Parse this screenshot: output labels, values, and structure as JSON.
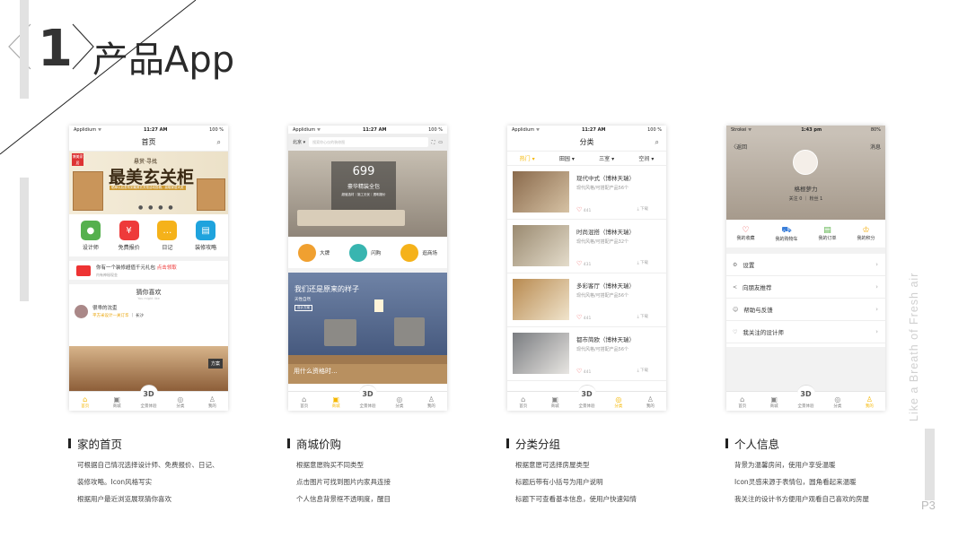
{
  "header": {
    "number": "1",
    "title": "产品App"
  },
  "side_text": "Like a Breath of Fresh air",
  "page_number": "P3",
  "phone1": {
    "status": {
      "carrier": "Applidium ᯤ",
      "time": "11:27 AM",
      "battery": "100 %"
    },
    "title": "首页",
    "banner": {
      "label": "博美家居",
      "small": "悬赏·寻找",
      "big": "最美玄关柜",
      "sub": "晒单以后发布到最美玄关柜活动投稿，赢取家居大奖"
    },
    "grid": [
      {
        "label": "设计师",
        "color": "#55b04e",
        "icon": "person"
      },
      {
        "label": "免费报价",
        "color": "#ee3a3a",
        "icon": "¥"
      },
      {
        "label": "日记",
        "color": "#f5b21a",
        "icon": "…"
      },
      {
        "label": "装修攻略",
        "color": "#1fa3dd",
        "icon": "▤"
      }
    ],
    "promo": {
      "text": "你有一个装修超值千元礼包",
      "link": "点击领取",
      "sub": "内有神秘现金"
    },
    "guess": {
      "title": "猜你喜欢",
      "sub": "You might like"
    },
    "designer": {
      "name": "很乖的沈歪",
      "detail": "平方米设计—关订华",
      "tag": "长沙"
    },
    "room_tag": "方案",
    "tabs": [
      "首页",
      "商城",
      "全景体验",
      "分类",
      "我的"
    ],
    "mid_icon": "3D"
  },
  "phone2": {
    "status": {
      "carrier": "Applidium ᯤ",
      "time": "11:27 AM",
      "battery": "100 %"
    },
    "location": "北京 ▾",
    "search_placeholder": "搜索你心仪的装修图",
    "hero": {
      "price": "699",
      "title": "豪华精装全包",
      "sub": "超值选材｜施工无忧｜透明报价"
    },
    "links": [
      {
        "label": "大牌",
        "color": "#f0a030"
      },
      {
        "label": "闪购",
        "color": "#38b5b0"
      },
      {
        "label": "逛商场",
        "color": "#f5b21a"
      }
    ],
    "feature": {
      "title": "我们还是原来的样子",
      "sub": "天性自然",
      "btn": "设计方案"
    },
    "strip": "用什么资格时...",
    "tabs": [
      "首页",
      "商城",
      "全景体验",
      "分类",
      "我的"
    ],
    "mid_icon": "3D"
  },
  "phone3": {
    "status": {
      "carrier": "Applidium ᯤ",
      "time": "11:27 AM",
      "battery": "100 %"
    },
    "title": "分类",
    "filters": [
      "热门 ▾",
      "田园 ▾",
      "三室 ▾",
      "空间 ▾"
    ],
    "items": [
      {
        "name": "现代中式（博林天瑞）",
        "desc": "现代风格/可搭配产品56个",
        "likes": "441",
        "download": "下载"
      },
      {
        "name": "时尚混搭（博林天瑞）",
        "desc": "现代风格/可搭配产品32个",
        "likes": "431",
        "download": "下载"
      },
      {
        "name": "多彩客厅（博林天瑞）",
        "desc": "现代风格/可搭配产品56个",
        "likes": "441",
        "download": "下载"
      },
      {
        "name": "都市简欧（博林天瑞）",
        "desc": "现代风格/可搭配产品56个",
        "likes": "441",
        "download": "下载"
      }
    ],
    "tabs": [
      "首页",
      "商城",
      "全景体验",
      "分类",
      "我的"
    ],
    "mid_icon": "3D"
  },
  "phone4": {
    "status": {
      "carrier": "Strokei ᯤ",
      "time": "1:43 pm",
      "battery": "80%"
    },
    "back": "〈返回",
    "message": "消息",
    "name": "格根萝力",
    "follow": "关注 0 ｜ 粉丝 1",
    "orders": [
      {
        "label": "我的收藏",
        "icon": "♡",
        "color": "#e44"
      },
      {
        "label": "我的购物车",
        "icon": "⛟",
        "color": "#3b7fd9"
      },
      {
        "label": "我的订单",
        "icon": "▤",
        "color": "#5bb34a"
      },
      {
        "label": "我的积分",
        "icon": "♔",
        "color": "#f5b21a"
      }
    ],
    "menu": [
      {
        "label": "设置",
        "icon": "⚙"
      },
      {
        "label": "向朋友推荐",
        "icon": "<"
      },
      {
        "label": "帮助与反馈",
        "icon": "☺"
      },
      {
        "label": "我关注的设计师",
        "icon": "♡"
      }
    ],
    "tabs": [
      "首页",
      "商城",
      "全景体验",
      "分类",
      "我的"
    ],
    "mid_icon": "3D"
  },
  "captions": [
    {
      "title": "家的首页",
      "lines": [
        "可根据自己情况选择设计师、免费报价、日记、",
        "装修攻略。Icon风格写实",
        "根据用户最近浏览展现猜你喜欢"
      ]
    },
    {
      "title": "商城价购",
      "lines": [
        "根据意愿购买不同类型",
        "点击图片可找到图片内家具连接",
        "个人信息背景框不透明度，醒目"
      ]
    },
    {
      "title": "分类分组",
      "lines": [
        "根据意愿可选择房屋类型",
        "标题后带有小括号为用户说明",
        "标题下可查看基本信息，使用户快速知情"
      ]
    },
    {
      "title": "个人信息",
      "lines": [
        "背景为温馨房间，使用户享受温暖",
        "Icon灵感来源于表情包，圆角看起来温暖",
        "我关注的设计书方便用户观看自己喜欢的房屋"
      ]
    }
  ]
}
